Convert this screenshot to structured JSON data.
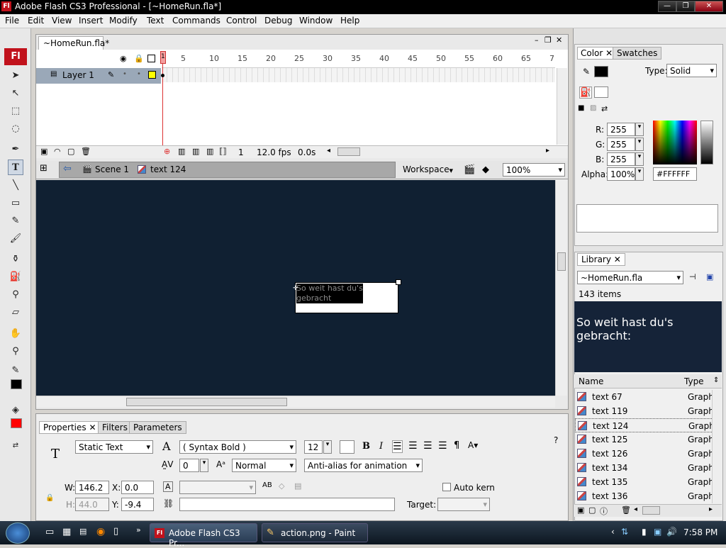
{
  "window": {
    "title": "Adobe Flash CS3 Professional - [~HomeRun.fla*]",
    "logo": "Fl"
  },
  "menu": [
    "File",
    "Edit",
    "View",
    "Insert",
    "Modify",
    "Text",
    "Commands",
    "Control",
    "Debug",
    "Window",
    "Help"
  ],
  "document": {
    "tab": "~HomeRun.fla*",
    "layer": "Layer 1",
    "frame_numbers": [
      "1",
      "5",
      "10",
      "15",
      "20",
      "25",
      "30",
      "35",
      "40",
      "45",
      "50",
      "55",
      "60",
      "65",
      "7"
    ],
    "timeline_status": {
      "frame": "1",
      "fps": "12.0 fps",
      "time": "0.0s"
    },
    "breadcrumb": {
      "scene": "Scene 1",
      "symbol": "text 124"
    },
    "workspace": "Workspace",
    "zoom": "100%",
    "text_line1": "So weit hast du's",
    "text_line2": "gebracht"
  },
  "properties": {
    "tabs": [
      "Properties",
      "Filters",
      "Parameters"
    ],
    "text_type": "Static Text",
    "font": "( Syntax Bold )",
    "size": "12",
    "letter_spacing": "0",
    "char_position": "Normal",
    "antialias": "Anti-alias for animation",
    "w": "146.2",
    "x": "0.0",
    "h": "44.0",
    "y": "-9.4",
    "w_label": "W:",
    "x_label": "X:",
    "h_label": "H:",
    "y_label": "Y:",
    "auto_kern": "Auto kern",
    "target": "Target:"
  },
  "color_panel": {
    "tabs": [
      "Color",
      "Swatches"
    ],
    "type_label": "Type:",
    "type": "Solid",
    "r_label": "R:",
    "r": "255",
    "g_label": "G:",
    "g": "255",
    "b_label": "B:",
    "b": "255",
    "alpha_label": "Alpha:",
    "alpha": "100%",
    "hex": "#FFFFFF"
  },
  "library": {
    "title": "Library",
    "file": "~HomeRun.fla",
    "count": "143 items",
    "preview_line1": "So weit hast du's",
    "preview_line2": "gebracht:",
    "col_name": "Name",
    "col_type": "Type",
    "items": [
      {
        "name": "text 67",
        "type": "Graph"
      },
      {
        "name": "text 119",
        "type": "Graph"
      },
      {
        "name": "text 124",
        "type": "Graph"
      },
      {
        "name": "text 125",
        "type": "Graph"
      },
      {
        "name": "text 126",
        "type": "Graph"
      },
      {
        "name": "text 134",
        "type": "Graph"
      },
      {
        "name": "text 135",
        "type": "Graph"
      },
      {
        "name": "text 136",
        "type": "Graph"
      }
    ]
  },
  "taskbar": {
    "tasks": [
      "Adobe Flash CS3 Pr...",
      "action.png - Paint"
    ],
    "clock": "7:58 PM"
  }
}
